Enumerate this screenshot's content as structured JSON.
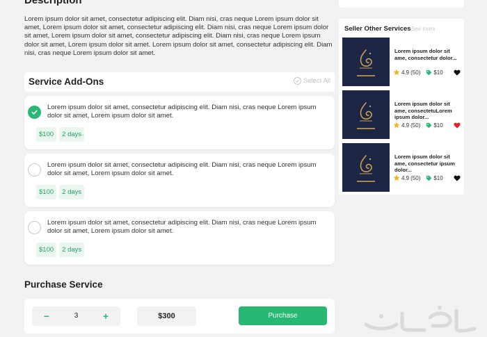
{
  "description": {
    "title": "Description",
    "text": "Lorem ipsum dolor sit amet, consectetur adipiscing elit. Diam nisi, cras neque Lorem ipsum dolor sit amet, Lorem ipsum dolor sit amet, consectetur adipiscing elit. Diam nisi, cras neque Lorem ipsum dolor sit amet, Lorem ipsum dolor sit amet, consectetur adipiscing elit. Diam nisi, cras neque Lorem ipsum dolor sit amet, Lorem ipsum dolor sit amet. Lorem ipsum dolor sit amet, consectetur adipiscing elit. Diam nisi, cras neque Lorem ipsum dolor sit amet."
  },
  "addons": {
    "title": "Service Add-Ons",
    "select_all": "Select All",
    "items": [
      {
        "text": "Lorem ipsum dolor sit amet, consectetur adipiscing elit. Diam nisi, cras neque Lorem ipsum dolor sit amet, Lorem ipsum dolor sit amet.",
        "price": "$100",
        "duration": "2 days",
        "checked": true
      },
      {
        "text": "Lorem ipsum dolor sit amet, consectetur adipiscing elit. Diam nisi, cras neque Lorem ipsum dolor sit amet, Lorem ipsum dolor sit amet.",
        "price": "$100",
        "duration": "2 days",
        "checked": false
      },
      {
        "text": "Lorem ipsum dolor sit amet, consectetur adipiscing elit. Diam nisi, cras neque Lorem ipsum dolor sit amet, Lorem ipsum dolor sit amet.",
        "price": "$100",
        "duration": "2 days",
        "checked": false
      }
    ]
  },
  "purchase": {
    "title": "Purchase Service",
    "quantity": "3",
    "minus": "−",
    "plus": "+",
    "total": "$300",
    "button": "Purchase"
  },
  "seller": {
    "title": "Seller Other Services",
    "see_more": "See more",
    "services": [
      {
        "title": "Lorem ipsum dolor sit ame, consectetur dolor...",
        "rating": "4.9",
        "reviews": "(50)",
        "price": "$10",
        "favorited": false
      },
      {
        "title": "Lorem ipsum dolor sit ame, consectetuLorem ipsum dolor...",
        "rating": "4.9",
        "reviews": "(50)",
        "price": "$10",
        "favorited": true
      },
      {
        "title": "Lorem ipsum dolor sit ame, consectetur ipsum dolor...",
        "rating": "4.9",
        "reviews": "(50)",
        "price": "$10",
        "favorited": false
      }
    ]
  },
  "icons": {
    "check": "check-icon",
    "star": "star-icon",
    "price_tag": "tag-icon",
    "heart": "heart-icon"
  },
  "colors": {
    "accent": "#27b973",
    "tag_bg": "#e9f7f0",
    "star": "#f3b51d",
    "heart_active": "#e0262b",
    "heart_inactive": "#111111",
    "thumb_bg": "#1d2545"
  }
}
